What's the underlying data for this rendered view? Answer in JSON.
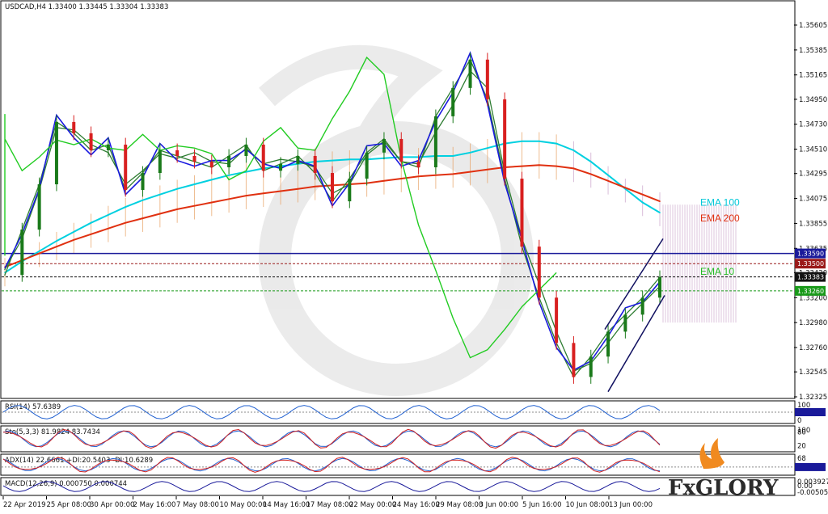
{
  "header": {
    "symbol_info": "USDCAD,H4  1.33400 1.33445 1.33304 1.33383"
  },
  "colors": {
    "price": "#2e7d32",
    "ema10": "#2e7d32",
    "ema100": "#00d0e0",
    "ema200": "#e03010",
    "kijun": "#1a1adf",
    "chikou": "#22cc22",
    "cloud_bull": "#e8a060",
    "cloud_bear": "#c8a0c8",
    "hline_blue": "#1a1a9a",
    "hline_red": "#9a1a1a",
    "hline_green": "#1a9a1a"
  },
  "chart_data": [
    {
      "type": "line",
      "title": "USDCAD,H4 1.33400 1.33445 1.33304 1.33383",
      "ylim": [
        1.32325,
        1.35605
      ],
      "y_ticks": [
        "1.35605",
        "1.35385",
        "1.35165",
        "1.34950",
        "1.34730",
        "1.34510",
        "1.34295",
        "1.34075",
        "1.33855",
        "1.33635",
        "1.33420",
        "1.33200",
        "1.32980",
        "1.32760",
        "1.32545",
        "1.32325"
      ],
      "x_ticks": [
        "22 Apr 2019",
        "25 Apr 08:00",
        "30 Apr 00:00",
        "2 May 16:00",
        "7 May 08:00",
        "10 May 00:00",
        "14 May 16:00",
        "17 May 08:00",
        "22 May 00:00",
        "24 May 16:00",
        "29 May 08:00",
        "3 Jun 00:00",
        "5 Jun 16:00",
        "10 Jun 08:00",
        "13 Jun 00:00"
      ],
      "price_tags": [
        {
          "value": 1.3359,
          "label": "1.33590",
          "color": "#1a1a9a"
        },
        {
          "value": 1.335,
          "label": "1.33500",
          "color": "#9a1a1a"
        },
        {
          "value": 1.33383,
          "label": "1.33383",
          "color": "#111111"
        },
        {
          "value": 1.3326,
          "label": "1.33260",
          "color": "#1a9a1a"
        }
      ],
      "series": [
        {
          "name": "EMA 100",
          "label_color": "#00c8d8",
          "values": [
            1.3342,
            1.3352,
            1.3361,
            1.337,
            1.3378,
            1.3386,
            1.3393,
            1.34,
            1.3406,
            1.3411,
            1.3416,
            1.342,
            1.3424,
            1.3428,
            1.3431,
            1.3434,
            1.3436,
            1.3438,
            1.344,
            1.3441,
            1.3442,
            1.3442,
            1.3443,
            1.3444,
            1.3444,
            1.3445,
            1.3445,
            1.3448,
            1.3452,
            1.3456,
            1.3458,
            1.3458,
            1.3456,
            1.345,
            1.344,
            1.3428,
            1.3416,
            1.3404,
            1.3395
          ]
        },
        {
          "name": "EMA 200",
          "label_color": "#e03010",
          "values": [
            1.3347,
            1.3353,
            1.3359,
            1.3365,
            1.3371,
            1.3376,
            1.3381,
            1.3386,
            1.339,
            1.3394,
            1.3398,
            1.3401,
            1.3404,
            1.3407,
            1.341,
            1.3412,
            1.3414,
            1.3416,
            1.3418,
            1.3419,
            1.342,
            1.3421,
            1.3423,
            1.3425,
            1.3427,
            1.3428,
            1.3429,
            1.3431,
            1.3433,
            1.3435,
            1.3436,
            1.3437,
            1.3436,
            1.3434,
            1.3429,
            1.3423,
            1.3417,
            1.3411,
            1.3405
          ]
        },
        {
          "name": "EMA 10",
          "label_color": "#22bb22",
          "values": [
            1.3345,
            1.3372,
            1.3415,
            1.347,
            1.3468,
            1.3455,
            1.3448,
            1.342,
            1.3432,
            1.3447,
            1.3443,
            1.3448,
            1.344,
            1.3438,
            1.3452,
            1.3438,
            1.3442,
            1.344,
            1.3435,
            1.3412,
            1.342,
            1.3446,
            1.3458,
            1.344,
            1.3438,
            1.3466,
            1.349,
            1.352,
            1.3505,
            1.343,
            1.3372,
            1.3332,
            1.329,
            1.3255,
            1.3262,
            1.328,
            1.33,
            1.3315,
            1.333
          ]
        },
        {
          "name": "",
          "values": [
            1.334,
            1.338,
            1.342,
            1.3475,
            1.3465,
            1.345,
            1.3455,
            1.3415,
            1.343,
            1.345,
            1.3445,
            1.344,
            1.3435,
            1.3445,
            1.3455,
            1.3432,
            1.3438,
            1.3445,
            1.343,
            1.3405,
            1.3425,
            1.3448,
            1.346,
            1.344,
            1.3435,
            1.348,
            1.3505,
            1.353,
            1.3495,
            1.3425,
            1.3365,
            1.332,
            1.328,
            1.325,
            1.3268,
            1.329,
            1.3305,
            1.332,
            1.3338
          ]
        }
      ],
      "annotations": [
        "EMA 100",
        "EMA 200",
        "EMA 10"
      ],
      "grid": false
    },
    {
      "type": "line",
      "title": "RSI(14) 57.6389",
      "ylim": [
        0,
        100
      ],
      "y_ticks": [
        "100",
        "50.0000",
        "0"
      ],
      "levels": [
        50
      ]
    },
    {
      "type": "line",
      "title": "Sto(5,3,3) 81.9824 83.7434",
      "ylim": [
        0,
        100
      ],
      "y_ticks": [
        "100",
        "80",
        "20"
      ]
    },
    {
      "type": "line",
      "title": "ADX(14) 22.6661 +DI:20.5403 -DI:10.6289",
      "ylim": [
        0,
        68
      ],
      "y_ticks": [
        "68",
        "25.0000"
      ],
      "levels": [
        25
      ]
    },
    {
      "type": "bar",
      "title": "MACD(12,26,9) 0.000750 0.000744",
      "ylim": [
        -0.005058,
        0.003927
      ],
      "y_ticks": [
        "0.003927",
        "0.00",
        "-0.005058"
      ]
    }
  ],
  "logo": {
    "brand": "FxGLORY"
  }
}
